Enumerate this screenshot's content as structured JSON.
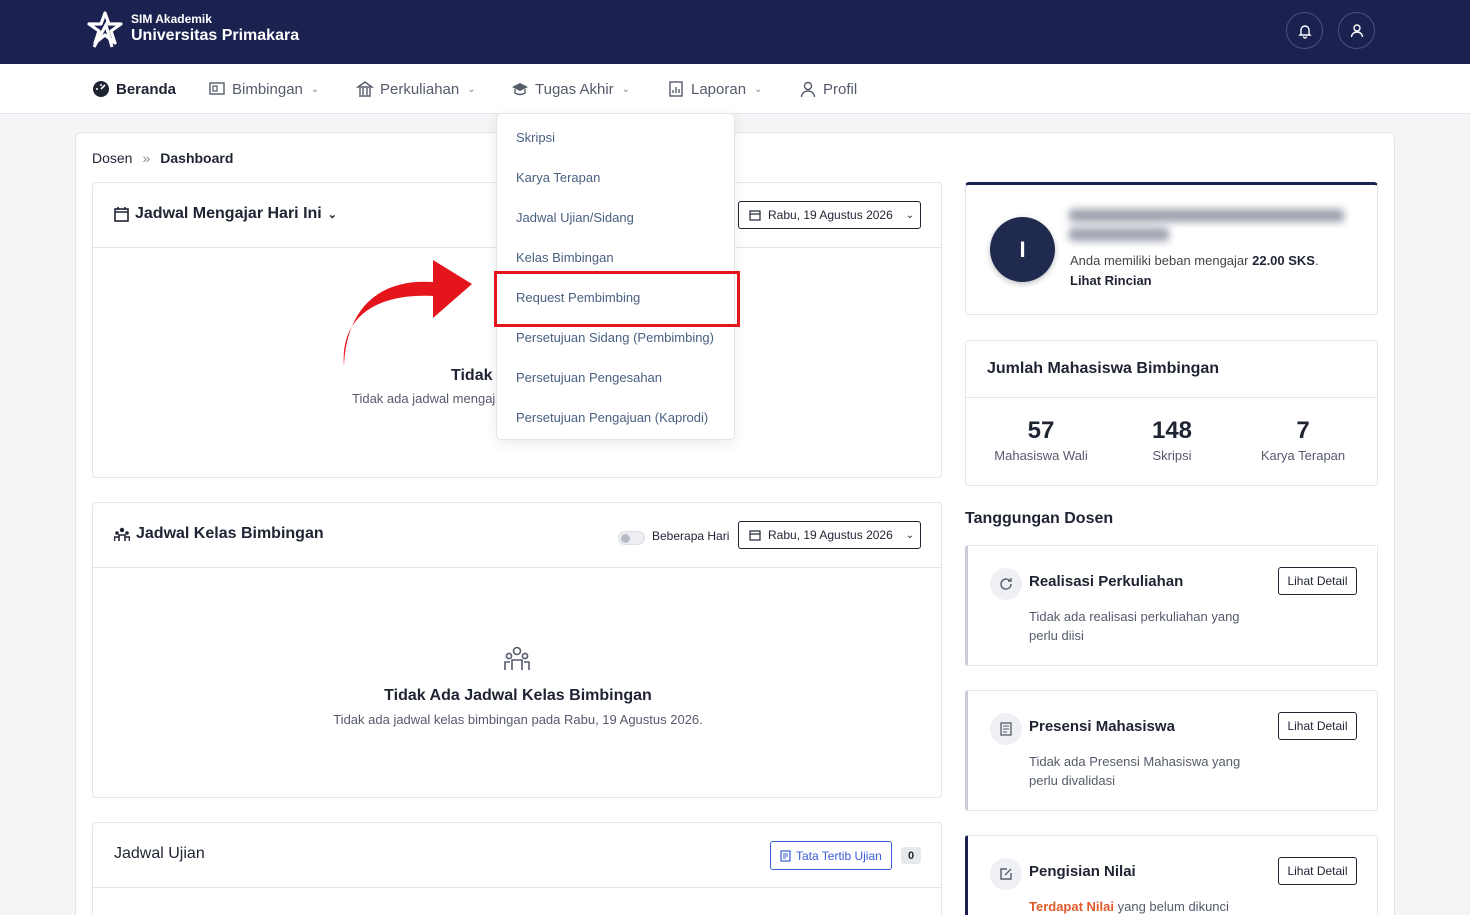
{
  "header": {
    "subtitle": "SIM Akademik",
    "title": "Universitas Primakara",
    "notification_icon": "bell-icon",
    "profile_icon": "user-icon"
  },
  "nav": [
    {
      "label": "Beranda",
      "icon": "dashboard-icon"
    },
    {
      "label": "Bimbingan",
      "icon": "presentation-icon"
    },
    {
      "label": "Perkuliahan",
      "icon": "building-icon"
    },
    {
      "label": "Tugas Akhir",
      "icon": "graduation-cap-icon"
    },
    {
      "label": "Laporan",
      "icon": "report-icon"
    },
    {
      "label": "Profil",
      "icon": "user-icon"
    }
  ],
  "dropdown": {
    "items": [
      "Skripsi",
      "Karya Terapan",
      "Jadwal Ujian/Sidang",
      "Kelas Bimbingan",
      "Request Pembimbing",
      "Persetujuan Sidang (Pembimbing)",
      "Persetujuan Pengesahan",
      "Persetujuan Pengajuan (Kaprodi)"
    ],
    "highlighted": "Request Pembimbing",
    "highlight_color": "#e4151b"
  },
  "breadcrumb": {
    "root": "Dosen",
    "separator": "»",
    "current": "Dashboard"
  },
  "jadwal_mengajar": {
    "title": "Jadwal Mengajar Hari Ini",
    "date": "Rabu, 19 Agustus 2026",
    "empty_title": "Tidak",
    "empty_sub": "Tidak ada jadwal mengaj"
  },
  "jadwal_bimbingan": {
    "title": "Jadwal Kelas Bimbingan",
    "toggle_label": "Beberapa Hari",
    "date": "Rabu, 19 Agustus 2026",
    "empty_title": "Tidak Ada Jadwal Kelas Bimbingan",
    "empty_sub": "Tidak ada jadwal kelas bimbingan pada Rabu, 19 Agustus 2026."
  },
  "jadwal_ujian": {
    "title": "Jadwal Ujian",
    "tata_tertib": "Tata Tertib Ujian",
    "count": "0"
  },
  "profile": {
    "initial": "I",
    "load_prefix": "Anda memiliki beban mengajar ",
    "load_value": "22.00 SKS",
    "load_suffix": ".",
    "detail_link": "Lihat Rincian"
  },
  "bimbingan_stats": {
    "title": "Jumlah Mahasiswa Bimbingan",
    "items": [
      {
        "value": "57",
        "label": "Mahasiswa Wali"
      },
      {
        "value": "148",
        "label": "Skripsi"
      },
      {
        "value": "7",
        "label": "Karya Terapan"
      }
    ]
  },
  "tanggungan": {
    "title": "Tanggungan Dosen",
    "detail_label": "Lihat Detail",
    "items": [
      {
        "title": "Realisasi Perkuliahan",
        "desc": "Tidak ada realisasi perkuliahan yang perlu diisi",
        "icon": "refresh-icon"
      },
      {
        "title": "Presensi Mahasiswa",
        "desc": "Tidak ada Presensi Mahasiswa yang perlu divalidasi",
        "icon": "document-icon"
      },
      {
        "title": "Pengisian Nilai",
        "desc_highlight": "Terdapat Nilai",
        "desc_rest": " yang belum dikunci",
        "icon": "edit-icon"
      }
    ]
  }
}
